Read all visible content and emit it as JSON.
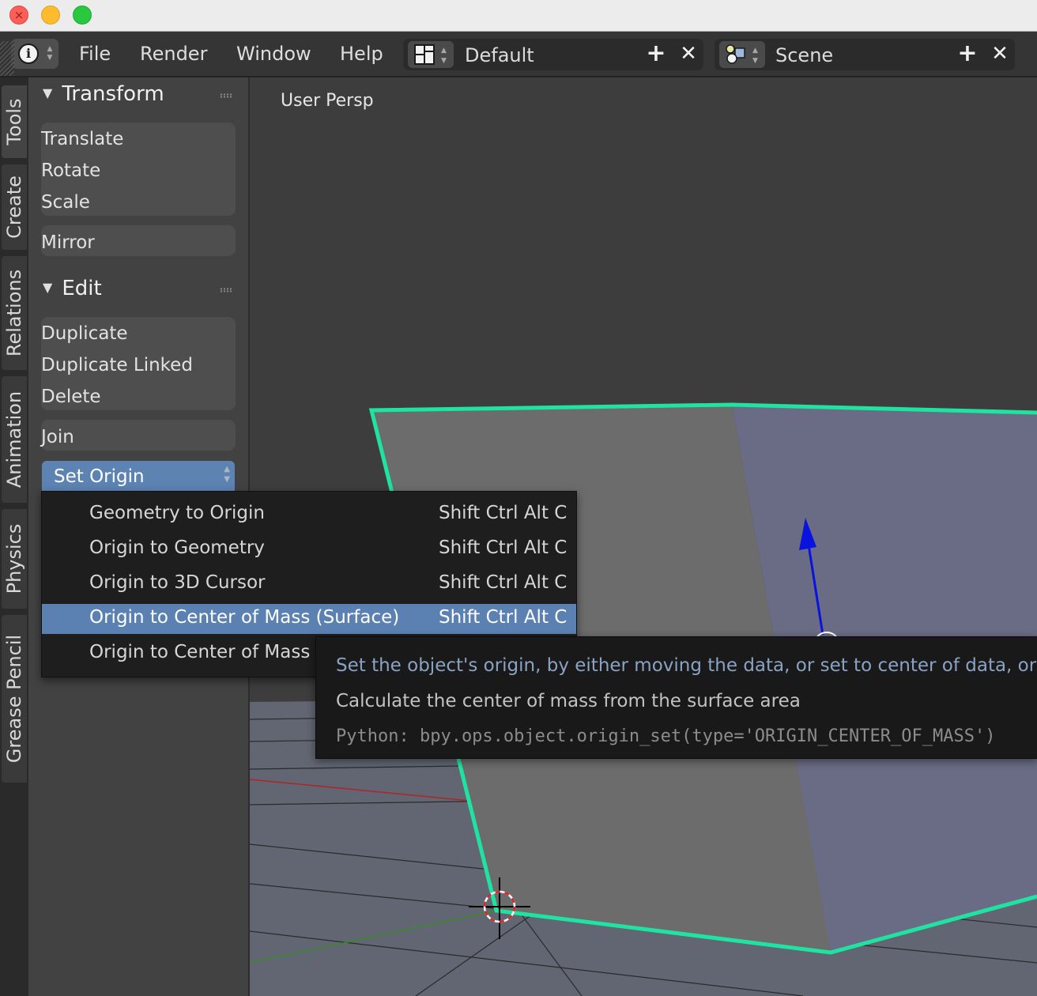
{
  "header": {
    "menus": [
      "File",
      "Render",
      "Window",
      "Help"
    ],
    "layout": "Default",
    "scene": "Scene",
    "add_symbol": "+",
    "remove_symbol": "✕"
  },
  "tabs": [
    "Tools",
    "Create",
    "Relations",
    "Animation",
    "Physics",
    "Grease Pencil"
  ],
  "tools": {
    "transform_header": "Transform",
    "transform_buttons": [
      "Translate",
      "Rotate",
      "Scale"
    ],
    "mirror": "Mirror",
    "edit_header": "Edit",
    "edit_buttons": [
      "Duplicate",
      "Duplicate Linked",
      "Delete"
    ],
    "join": "Join",
    "set_origin": "Set Origin"
  },
  "origin_menu": {
    "items": [
      {
        "label": "Geometry to Origin",
        "shortcut": "Shift Ctrl Alt C"
      },
      {
        "label": "Origin to Geometry",
        "shortcut": "Shift Ctrl Alt C"
      },
      {
        "label": "Origin to 3D Cursor",
        "shortcut": "Shift Ctrl Alt C"
      },
      {
        "label": "Origin to Center of Mass (Surface)",
        "shortcut": "Shift Ctrl Alt C",
        "highlighted": true
      },
      {
        "label": "Origin to Center of Mass",
        "shortcut": ""
      }
    ]
  },
  "tooltip": {
    "description": "Set the object's origin, by either moving the data, or set to center of data, or",
    "detail": "Calculate the center of mass from the surface area",
    "python": "Python: bpy.ops.object.origin_set(type='ORIGIN_CENTER_OF_MASS')"
  },
  "viewport": {
    "label": "User Persp",
    "selection_color": "#1fe3a0",
    "z_axis_color": "#0a12e0"
  },
  "colors": {
    "header_bg": "#353535",
    "panel_bg": "#424242",
    "highlight": "#5b81b2",
    "tooltip_bg": "#191919"
  }
}
